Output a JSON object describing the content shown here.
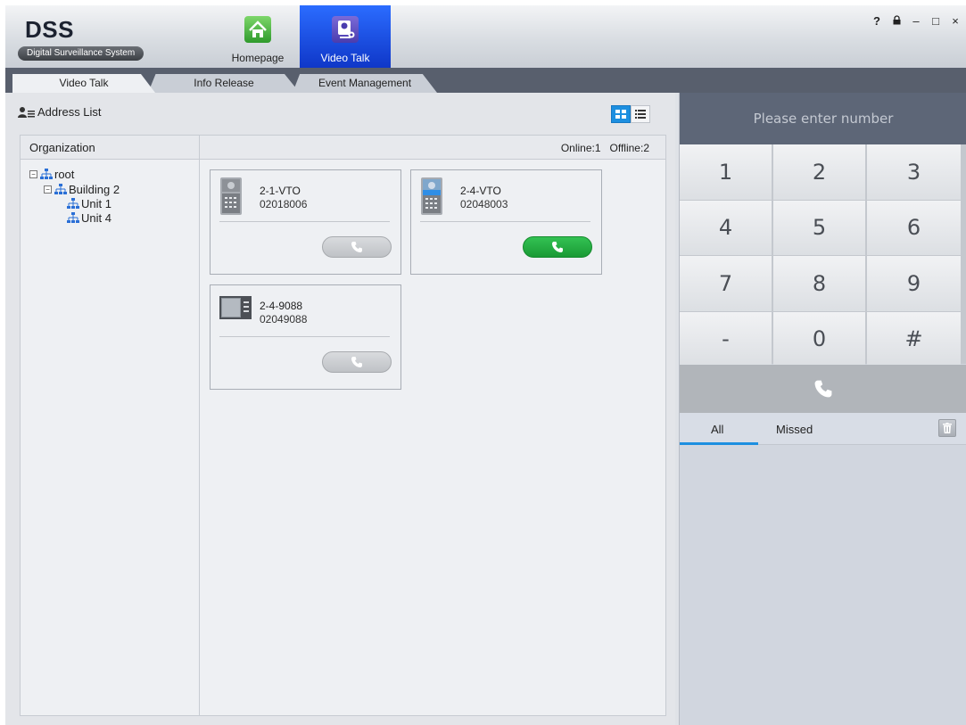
{
  "app": {
    "logo_title": "DSS",
    "logo_subtitle": "Digital Surveillance System"
  },
  "modules": {
    "homepage": "Homepage",
    "videotalk": "Video Talk"
  },
  "window_controls": {
    "help": "?",
    "lock": "⌂",
    "minimize": "–",
    "maximize": "□",
    "close": "×"
  },
  "tabs": [
    "Video Talk",
    "Info Release",
    "Event Management"
  ],
  "address_list": {
    "label": "Address List"
  },
  "organization": {
    "header": "Organization",
    "tree": [
      {
        "label": "root",
        "toggle": "−"
      },
      {
        "label": "Building 2",
        "toggle": "−"
      },
      {
        "label": "Unit 1"
      },
      {
        "label": "Unit 4"
      }
    ]
  },
  "status": {
    "online": "Online:1",
    "offline": "Offline:2"
  },
  "devices": [
    {
      "name": "2-1-VTO",
      "number": "02018006",
      "online": false,
      "type": "vto-grey"
    },
    {
      "name": "2-4-VTO",
      "number": "02048003",
      "online": true,
      "type": "vto-blue"
    },
    {
      "name": "2-4-9088",
      "number": "02049088",
      "online": false,
      "type": "indoor-monitor"
    }
  ],
  "dialpad": {
    "placeholder": "Please enter number",
    "keys": [
      "1",
      "2",
      "3",
      "4",
      "5",
      "6",
      "7",
      "8",
      "9",
      "-",
      "0",
      "#"
    ]
  },
  "history": {
    "tabs": [
      "All",
      "Missed"
    ],
    "active_tab": "All"
  },
  "colors": {
    "accent": "#1d8fe0",
    "online_call": "#22a83d",
    "module_active": "#1f4fe0"
  }
}
